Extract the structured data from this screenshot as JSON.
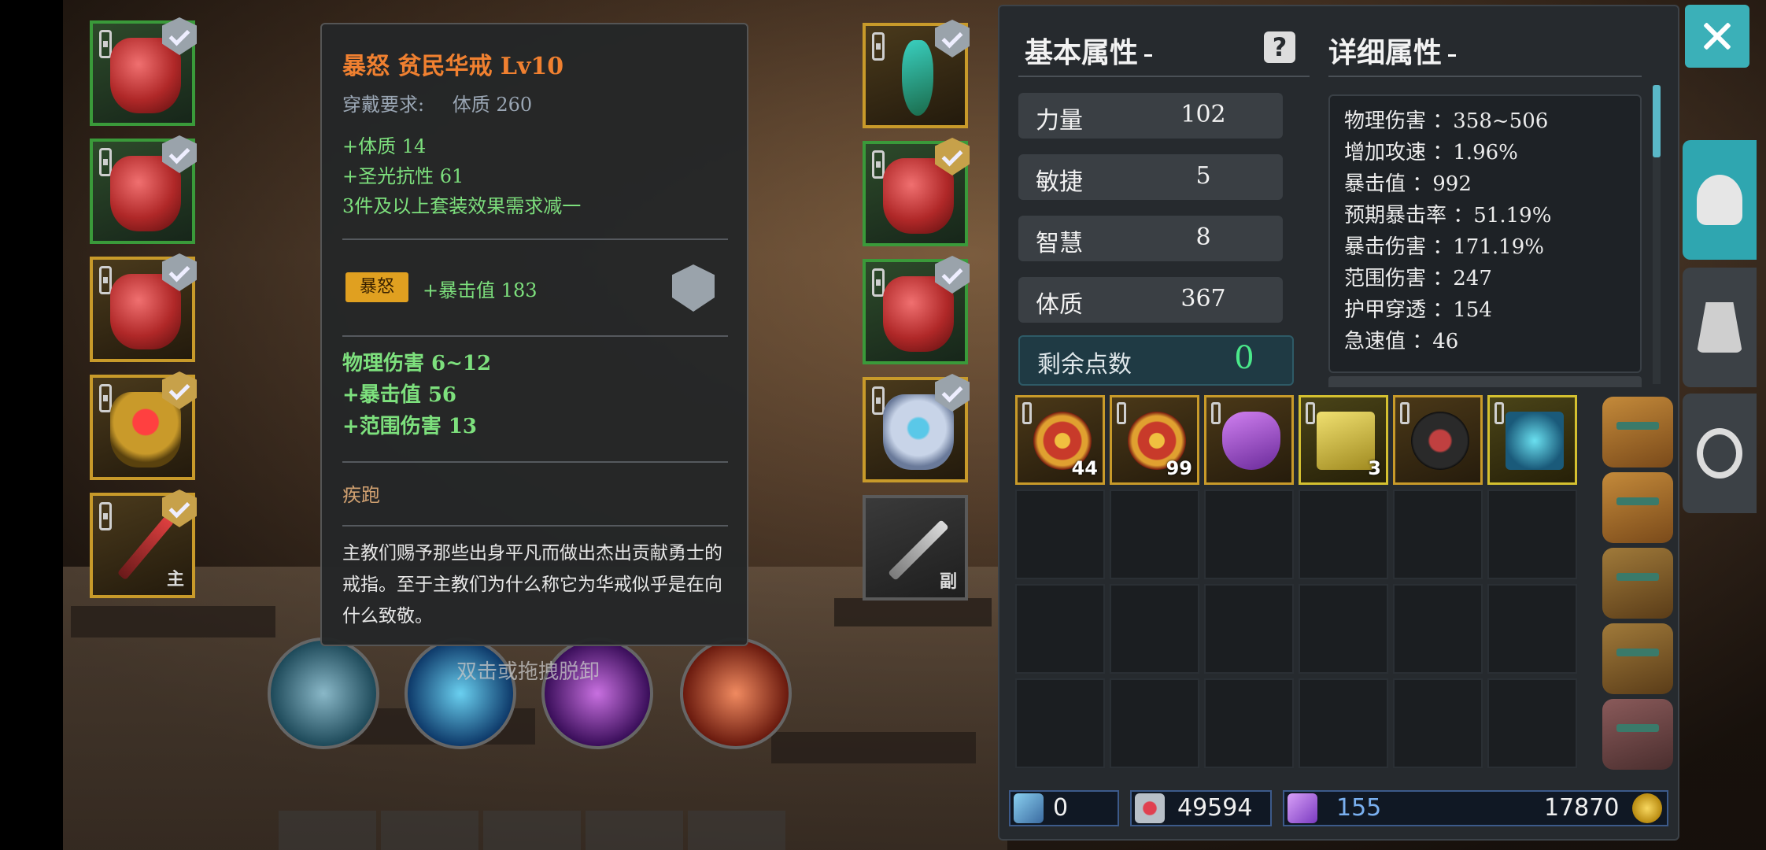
{
  "tooltip": {
    "title": "暴怒  贫民华戒  Lv10",
    "requirement_label": "穿戴要求:",
    "requirement_value": "体质  260",
    "lines": [
      "+体质  14",
      "+圣光抗性  61",
      "3件及以上套装效果需求减一"
    ],
    "set_badge": "暴怒",
    "set_bonus": "+暴击值  183",
    "stats": [
      "物理伤害  6~12",
      "+暴击值  56",
      "+范围伤害  13"
    ],
    "skill": "疾跑",
    "description": "主教们赐予那些出身平凡而做出杰出贡献勇士的戒指。至于主教们为什么称它为华戒似乎是在向什么致敬。"
  },
  "hint": "双击或拖拽脱卸",
  "equipment": {
    "left_weapon_tag": "主",
    "right_weapon_tag": "副"
  },
  "panel": {
    "basic_title": "基本属性",
    "detail_title": "详细属性",
    "help_label": "?",
    "attributes": [
      {
        "label": "力量",
        "value": "102"
      },
      {
        "label": "敏捷",
        "value": "5"
      },
      {
        "label": "智慧",
        "value": "8"
      },
      {
        "label": "体质",
        "value": "367"
      }
    ],
    "points_label": "剩余点数",
    "points_value": "0",
    "details": [
      "物理伤害 ：358~506",
      "增加攻速 ：1.96%",
      "暴击值 ：992",
      "预期暴击率 ：51.19%",
      "暴击伤害 ：171.19%",
      "范围伤害 ：247",
      "护甲穿透 ：154",
      "急速值 ：46"
    ]
  },
  "inventory": {
    "counts": [
      "44",
      "99",
      "",
      "3",
      "",
      ""
    ]
  },
  "currency": {
    "gems": "0",
    "hearts": "49594",
    "crystals": "155",
    "gold": "17870"
  },
  "colors": {
    "accent": "#3bb0b8",
    "title_orange": "#f08030",
    "stat_green": "#7de07d",
    "points_green": "#4ae88a"
  }
}
